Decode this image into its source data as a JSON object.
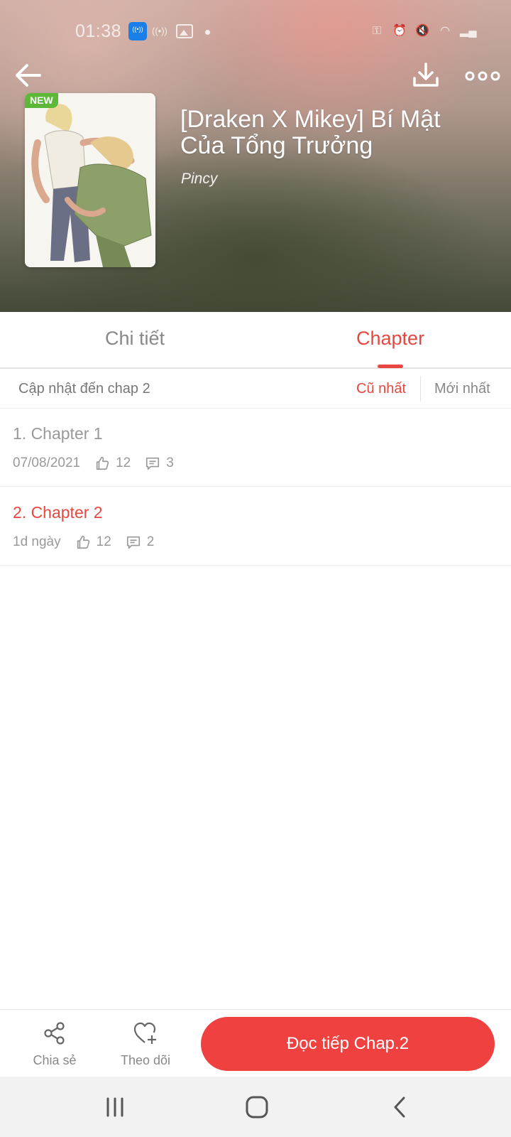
{
  "status_bar": {
    "time": "01:38",
    "icons": [
      "app-wireless-icon",
      "radio-icon",
      "image-icon",
      "dot-icon",
      "key-icon",
      "alarm-icon",
      "mute-icon",
      "wifi-icon",
      "signal-icon"
    ]
  },
  "header": {
    "back_icon": "back-arrow-icon",
    "download_icon": "download-icon",
    "more_icon": "more-icon",
    "badge": "NEW",
    "title_line1": "[Draken X Mikey] Bí Mật",
    "title_line2": "Của Tổng Trưởng",
    "author": "Pincy"
  },
  "tabs": [
    {
      "label": "Chi tiết",
      "active": false
    },
    {
      "label": "Chapter",
      "active": true
    }
  ],
  "update_bar": {
    "text": "Cập nhật đến chap 2",
    "sort_oldest": "Cũ nhất",
    "sort_newest": "Mới nhất"
  },
  "chapters": [
    {
      "title": "1. Chapter 1",
      "date": "07/08/2021",
      "likes": "12",
      "comments": "3",
      "highlight": false
    },
    {
      "title": "2. Chapter 2",
      "date": "1d ngày",
      "likes": "12",
      "comments": "2",
      "highlight": true
    }
  ],
  "bottom_bar": {
    "share_label": "Chia sẻ",
    "follow_label": "Theo dõi",
    "read_label": "Đọc tiếp Chap.2"
  },
  "colors": {
    "accent": "#e8473f",
    "button": "#f04141",
    "badge": "#5db739",
    "muted": "#999999"
  }
}
